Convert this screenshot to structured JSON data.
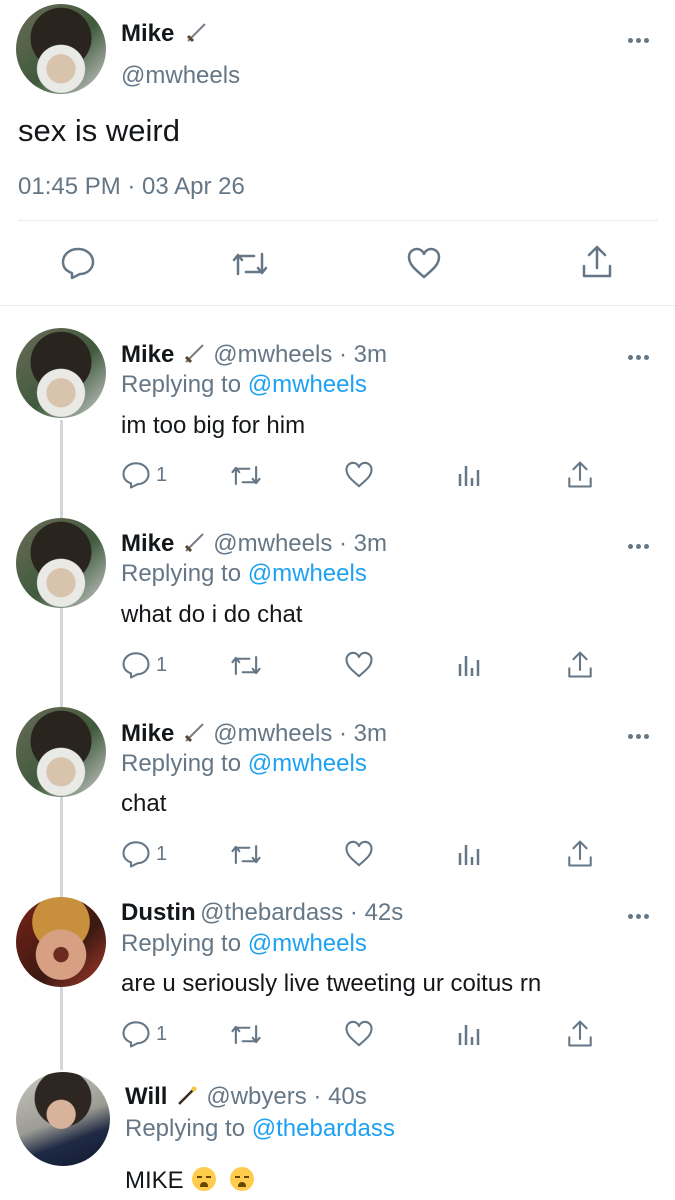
{
  "main_tweet": {
    "display_name": "Mike",
    "name_icon": "sword-emoji",
    "handle": "@mwheels",
    "text": "sex is weird",
    "timestamp": "01:45 PM · 03 Apr 26",
    "actions": [
      "reply-icon",
      "retweet-icon",
      "like-icon",
      "share-icon"
    ]
  },
  "replies": [
    {
      "display_name": "Mike",
      "name_icon": "sword-emoji",
      "handle_time": "@mwheels · 3m",
      "replying_prefix": "Replying to",
      "replying_to": "@mwheels",
      "text": "im too big for him",
      "reply_count": "1"
    },
    {
      "display_name": "Mike",
      "name_icon": "sword-emoji",
      "handle_time": "@mwheels · 3m",
      "replying_prefix": "Replying to",
      "replying_to": "@mwheels",
      "text": "what do i do chat",
      "reply_count": "1"
    },
    {
      "display_name": "Mike",
      "name_icon": "sword-emoji",
      "handle_time": "@mwheels · 3m",
      "replying_prefix": "Replying to",
      "replying_to": "@mwheels",
      "text": "chat",
      "reply_count": "1"
    },
    {
      "display_name": "Dustin",
      "handle_time": "@thebardass · 42s",
      "replying_prefix": "Replying to",
      "replying_to": "@mwheels",
      "text": "are u seriously live tweeting ur coitus rn",
      "reply_count": "1"
    },
    {
      "display_name": "Will",
      "name_icon": "magic-wand-emoji",
      "handle_time": "@wbyers · 40s",
      "replying_prefix": "Replying to",
      "replying_to": "@thebardass",
      "text": "MIKE",
      "trailing_emojis": [
        "loudly-crying-face-emoji",
        "loudly-crying-face-emoji"
      ]
    }
  ],
  "colors": {
    "link": "#1da1f2",
    "muted": "#657786",
    "text": "#14171a",
    "divider": "#e6ecf0"
  }
}
